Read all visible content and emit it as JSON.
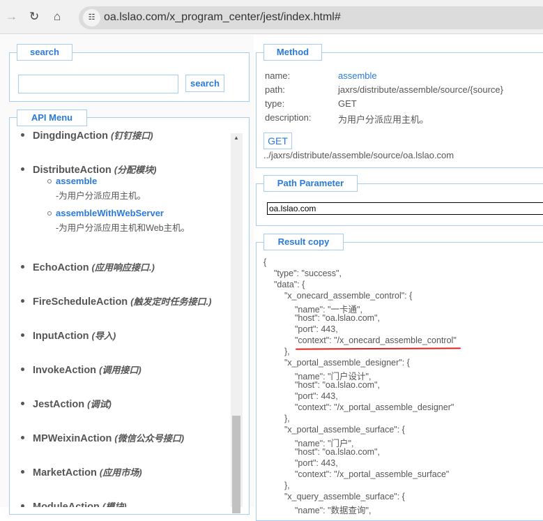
{
  "browser": {
    "url": "oa.lslao.com/x_program_center/jest/index.html#",
    "forward_icon": "arrow-right-icon",
    "reload_icon": "reload-icon",
    "home_icon": "home-icon",
    "site_info_icon": "tune-icon"
  },
  "search": {
    "legend": "search",
    "input_value": "",
    "button": "search"
  },
  "api_menu": {
    "legend": "API Menu",
    "items": [
      {
        "name": "DingdingAction",
        "desc": "(钉钉接口)"
      },
      {
        "name": "DistributeAction",
        "desc": "(分配模块)",
        "subs": [
          {
            "name": "assemble",
            "desc": "-为用户分派应用主机。"
          },
          {
            "name": "assembleWithWebServer",
            "desc": "-为用户分派应用主机和Web主机。"
          }
        ]
      },
      {
        "name": "EchoAction",
        "desc": "(应用响应接口.)"
      },
      {
        "name": "FireScheduleAction",
        "desc": "(触发定时任务接口.)"
      },
      {
        "name": "InputAction",
        "desc": "(导入)"
      },
      {
        "name": "InvokeAction",
        "desc": "(调用接口)"
      },
      {
        "name": "JestAction",
        "desc": "(调试)"
      },
      {
        "name": "MPWeixinAction",
        "desc": "(微信公众号接口)"
      },
      {
        "name": "MarketAction",
        "desc": "(应用市场)"
      },
      {
        "name": "ModuleAction",
        "desc": "(模块)"
      }
    ]
  },
  "method": {
    "legend": "Method",
    "name_label": "name:",
    "name": "assemble",
    "path_label": "path:",
    "path": "jaxrs/distribute/assemble/source/{source}",
    "type_label": "type:",
    "type": "GET",
    "desc_label": "description:",
    "desc": "为用户分派应用主机。",
    "button": "GET",
    "url": "../jaxrs/distribute/assemble/source/oa.lslao.com"
  },
  "path_param": {
    "legend": "Path Parameter",
    "value": "oa.lslao.com"
  },
  "result": {
    "legend": "Result copy",
    "highlight_color": "#e02020",
    "lines": [
      "{",
      "  \"type\": \"success\",",
      "  \"data\": {",
      "    \"x_onecard_assemble_control\": {",
      "      \"name\": \"一卡通\",",
      "      \"host\": \"oa.lslao.com\",",
      "      \"port\": 443,",
      "      \"context\": \"/x_onecard_assemble_control\"",
      "    },",
      "    \"x_portal_assemble_designer\": {",
      "      \"name\": \"门户设计\",",
      "      \"host\": \"oa.lslao.com\",",
      "      \"port\": 443,",
      "      \"context\": \"/x_portal_assemble_designer\"",
      "    },",
      "    \"x_portal_assemble_surface\": {",
      "      \"name\": \"门户\",",
      "      \"host\": \"oa.lslao.com\",",
      "      \"port\": 443,",
      "      \"context\": \"/x_portal_assemble_surface\"",
      "    },",
      "    \"x_query_assemble_surface\": {",
      "      \"name\": \"数据查询\","
    ]
  }
}
